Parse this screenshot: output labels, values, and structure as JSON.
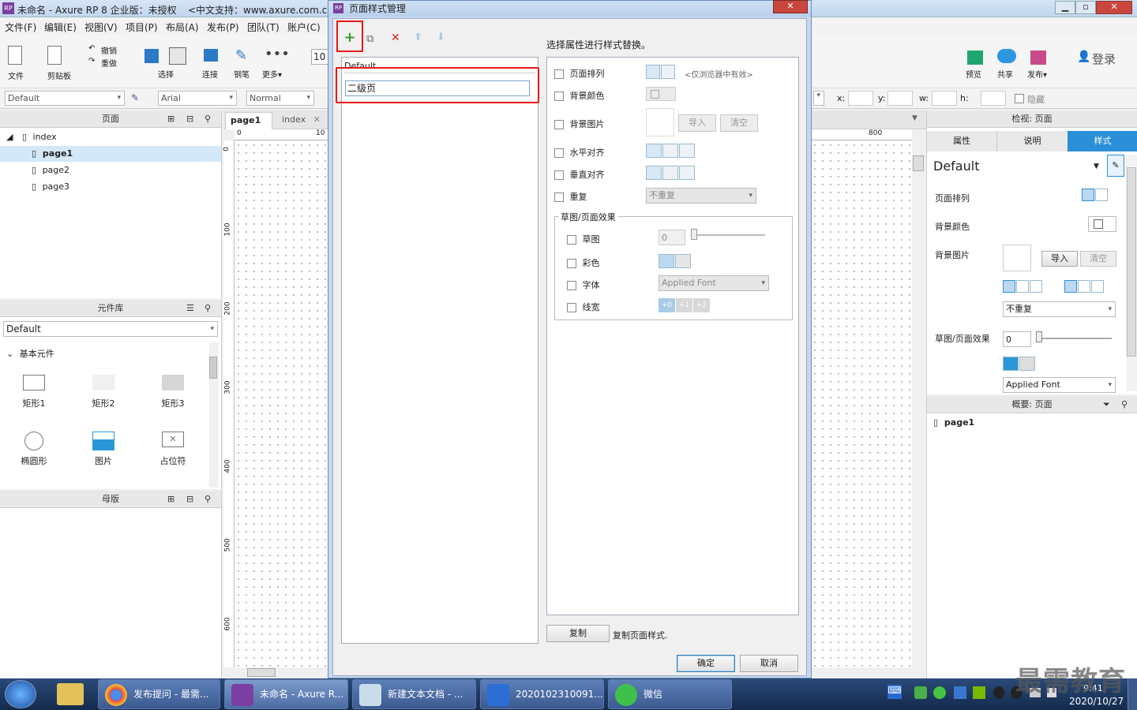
{
  "app": {
    "title": "未命名 - Axure RP 8 企业版：未授权",
    "support": "<中文支持：www.axure.com.cn"
  },
  "menu": [
    "文件(F)",
    "编辑(E)",
    "视图(V)",
    "项目(P)",
    "布局(A)",
    "发布(P)",
    "团队(T)",
    "账户(C)"
  ],
  "toolbar": {
    "file": "文件",
    "clipboard": "剪贴板",
    "undo": "撤销",
    "redo": "重做",
    "select": "选择",
    "connect": "连接",
    "pen": "钢笔",
    "more": "更多▾",
    "zoom": "10",
    "preview": "预览",
    "share": "共享",
    "publish": "发布▾",
    "login": "登录"
  },
  "formatbar": {
    "style": "Default",
    "font": "Arial",
    "weight": "Normal",
    "x": "x:",
    "y": "y:",
    "w": "w:",
    "h": "h:",
    "hidden": "隐藏"
  },
  "pages": {
    "title": "页面",
    "items": [
      "index",
      "page1",
      "page2",
      "page3"
    ]
  },
  "library": {
    "title": "元件库",
    "selected": "Default",
    "group": "基本元件",
    "widgets": [
      "矩形1",
      "矩形2",
      "矩形3",
      "椭圆形",
      "图片",
      "占位符"
    ]
  },
  "masters": {
    "title": "母版"
  },
  "canvas": {
    "tabs": [
      "page1",
      "index"
    ],
    "ruler_v": [
      "0",
      "100",
      "200",
      "300",
      "400",
      "500",
      "600"
    ],
    "ruler_h_left": "0",
    "ruler_h_mid": "10",
    "ruler_h_right": "800"
  },
  "inspector": {
    "title": "检视: 页面",
    "tabs": [
      "属性",
      "说明",
      "样式"
    ],
    "style": "Default",
    "layout": "页面排列",
    "bgcolor": "背景颜色",
    "bgimage": "背景图片",
    "import": "导入",
    "clear": "清空",
    "repeat": "不重复",
    "sketch": "草图/页面效果",
    "sketch_val": "0",
    "font": "Applied Font"
  },
  "outline": {
    "title": "概要: 页面",
    "item": "page1"
  },
  "dialog": {
    "title": "页面样式管理",
    "hint": "选择属性进行样式替换。",
    "styles": [
      "Default",
      "二级页"
    ],
    "props": [
      "页面排列",
      "背景颜色",
      "背景图片",
      "水平对齐",
      "垂直对齐",
      "重复"
    ],
    "browser_only": "<仅浏览器中有效>",
    "import": "导入",
    "clear": "清空",
    "repeat": "不重复",
    "group_title": "草图/页面效果",
    "effects": [
      "草图",
      "彩色",
      "字体",
      "线宽"
    ],
    "sketch_val": "0",
    "font": "Applied Font",
    "lw": [
      "+0",
      "+1",
      "+2"
    ],
    "copy_btn": "复制",
    "copy_desc": "复制页面样式.",
    "ok": "确定",
    "cancel": "取消"
  },
  "taskbar": {
    "items": [
      "发布提问 - 最需...",
      "未命名 - Axure R...",
      "新建文本文档 - ...",
      "2020102310091...",
      "微信"
    ],
    "date": "2020/10/27",
    "time": "9:41"
  },
  "watermark": "最需教育",
  "colors": {
    "accent": "#2a8fd6",
    "highlight": "#e81818",
    "titlebar": "#2e6ab4"
  }
}
